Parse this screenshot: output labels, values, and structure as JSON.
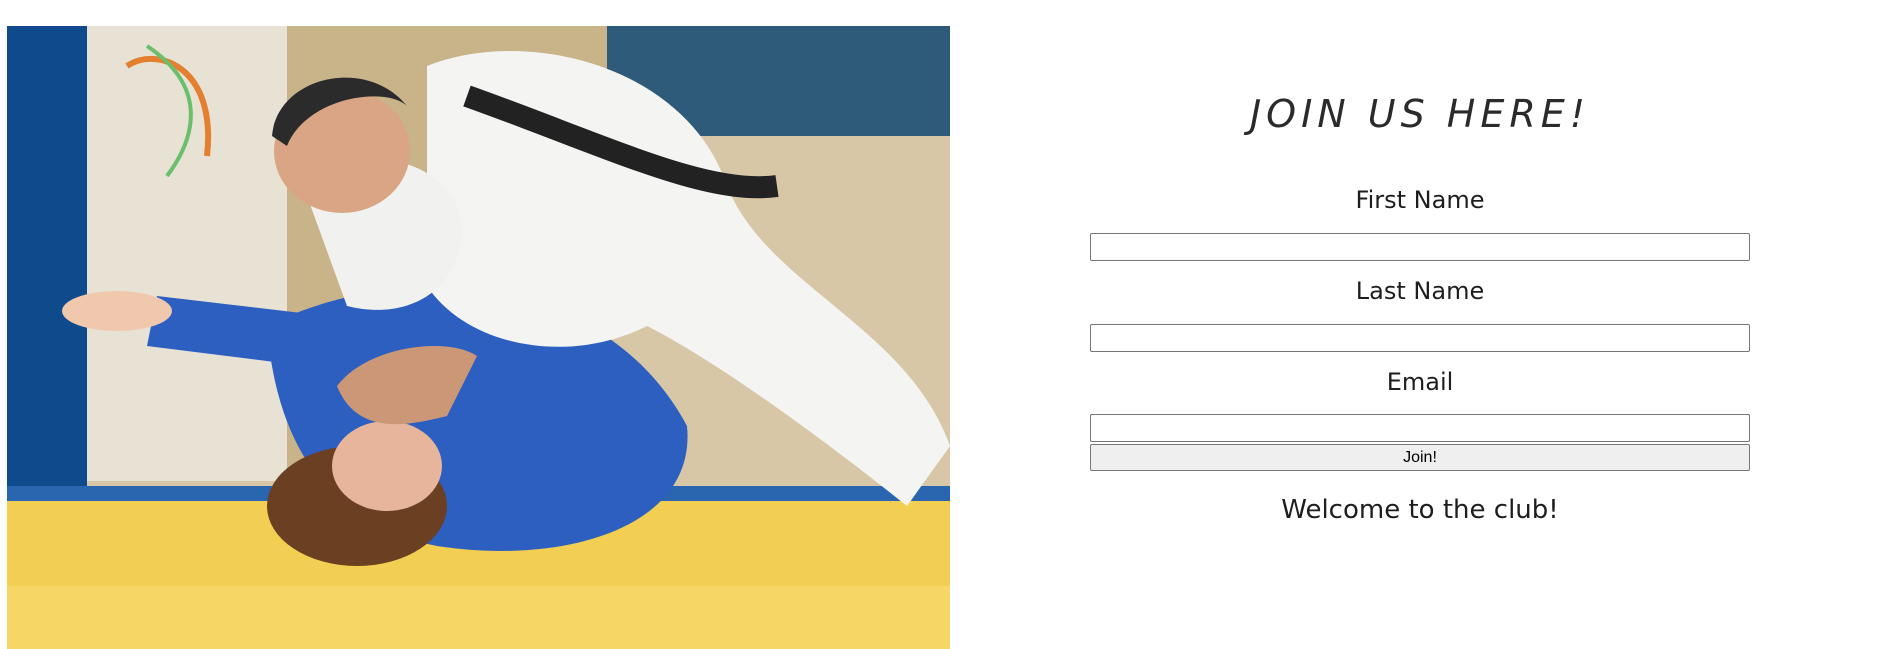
{
  "hero_image": {
    "alt": "Judo practitioners on a yellow mat"
  },
  "form": {
    "title": "JOIN US HERE!",
    "first_name_label": "First Name",
    "first_name_value": "",
    "last_name_label": "Last Name",
    "last_name_value": "",
    "email_label": "Email",
    "email_value": "",
    "submit_label": "Join!",
    "welcome_message": "Welcome to the club!"
  }
}
